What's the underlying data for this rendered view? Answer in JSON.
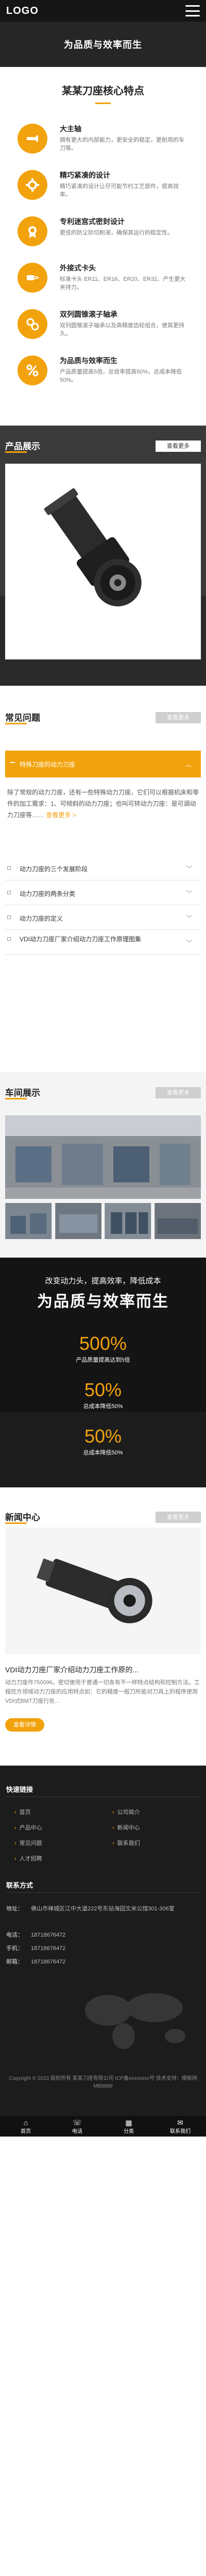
{
  "header": {
    "logo": "LOGO"
  },
  "hero": {
    "title": "为品质与效率而生"
  },
  "features": {
    "title": "某某刀座核心特点",
    "items": [
      {
        "name": "大主轴",
        "desc": "拥有更大的内部能力，更安全的稳定，更耐用的车刀等。",
        "icon": "shaft-icon"
      },
      {
        "name": "精巧紧凑的设计",
        "desc": "精巧紧凑的设计让尽可能节约工艺部件，提高效率。",
        "icon": "gear-icon"
      },
      {
        "name": "专利迷宫式密封设计",
        "desc": "更佳的防尘防切削液，确保其运行的稳定性。",
        "icon": "seal-icon"
      },
      {
        "name": "外接式卡头",
        "desc": "标准卡头 ER11、ER16、ER20、ER32、产生更大夹持力。",
        "icon": "plug-icon"
      },
      {
        "name": "双列圆锥滚子轴承",
        "desc": "双列圆锥滚子轴承以及高精度齿轮组合，使其更持久。",
        "icon": "bearing-icon"
      },
      {
        "name": "为品质与效率而生",
        "desc": "产品质量提高5倍，总效率提高50%，总成本降低50%。",
        "icon": "percent-icon"
      }
    ]
  },
  "products": {
    "title": "产品展示",
    "more": "查看更多"
  },
  "faq": {
    "title": "常见问题",
    "more": "查看更多",
    "active": {
      "question": "特殊刀座的动力刀座"
    },
    "answer": "除了常规的动力刀座，还有一些特殊动力刀座，它们可以根据机床和零件的加工需求：1、可倾斜的动力刀座；也叫可转动力刀座：是可调动力刀座等……",
    "readmore": "查看更多 >",
    "items": [
      {
        "question": "动力刀座的三个发展阶段"
      },
      {
        "question": "动力刀座的两条分类"
      },
      {
        "question": "动力刀座的定义"
      },
      {
        "question": "VDI动力刀座厂家介绍动力刀座工作原理图集"
      }
    ]
  },
  "workshop": {
    "title": "车间展示",
    "more": "查看更多"
  },
  "stats": {
    "tag": "改变动力头，提高效率，降低成本",
    "title": "为品质与效率而生",
    "items": [
      {
        "num": "500%",
        "label": "产品质量提高达到5倍"
      },
      {
        "num": "50%",
        "label": "总成本降低50%"
      },
      {
        "num": "50%",
        "label": "总成本降低50%"
      }
    ]
  },
  "news": {
    "title": "新闻中心",
    "more": "查看更多"
  },
  "article": {
    "title": "VDI动力刀座厂家介绍动力刀座工作原的...",
    "body": "动力刀座作750096。密切使用于普通一切各有不一样特点结构和控制方法。工程控方领域动力刀座的应用特点如：它的精度一般刀所能对刀具上的程序使用VDI式BMT刀座行处…",
    "button": "查看详情"
  },
  "footer": {
    "quick_title": "快速链接",
    "links_left": [
      "首页",
      "产品中心",
      "常见问题",
      "人才招聘"
    ],
    "links_right": [
      "公司简介",
      "新闻中心",
      "联系我们"
    ],
    "contact_title": "联系方式",
    "contact": [
      {
        "k": "地址：",
        "v": "佛山市禅城区江中大道222号东站海园文米公馆301-306室"
      },
      {
        "k": "电话：",
        "v": "18718676472"
      },
      {
        "k": "手机：",
        "v": "18718676472"
      },
      {
        "k": "邮箱：",
        "v": "18718676472"
      }
    ],
    "copyright": "Copyright © 2023 版权所有 某某刀座有限公司 ICP备xxxxxxxx号 技术支持：模板网MB8888"
  },
  "bottom_nav": [
    {
      "label": "首页",
      "icon": "home-icon",
      "glyph": "⌂"
    },
    {
      "label": "电话",
      "icon": "phone-icon",
      "glyph": "☏"
    },
    {
      "label": "分类",
      "icon": "grid-icon",
      "glyph": "▦"
    },
    {
      "label": "联系我们",
      "icon": "chat-icon",
      "glyph": "✉"
    }
  ],
  "colors": {
    "accent": "#f2a20c",
    "dark": "#151515",
    "footer": "#1c1c1c"
  }
}
